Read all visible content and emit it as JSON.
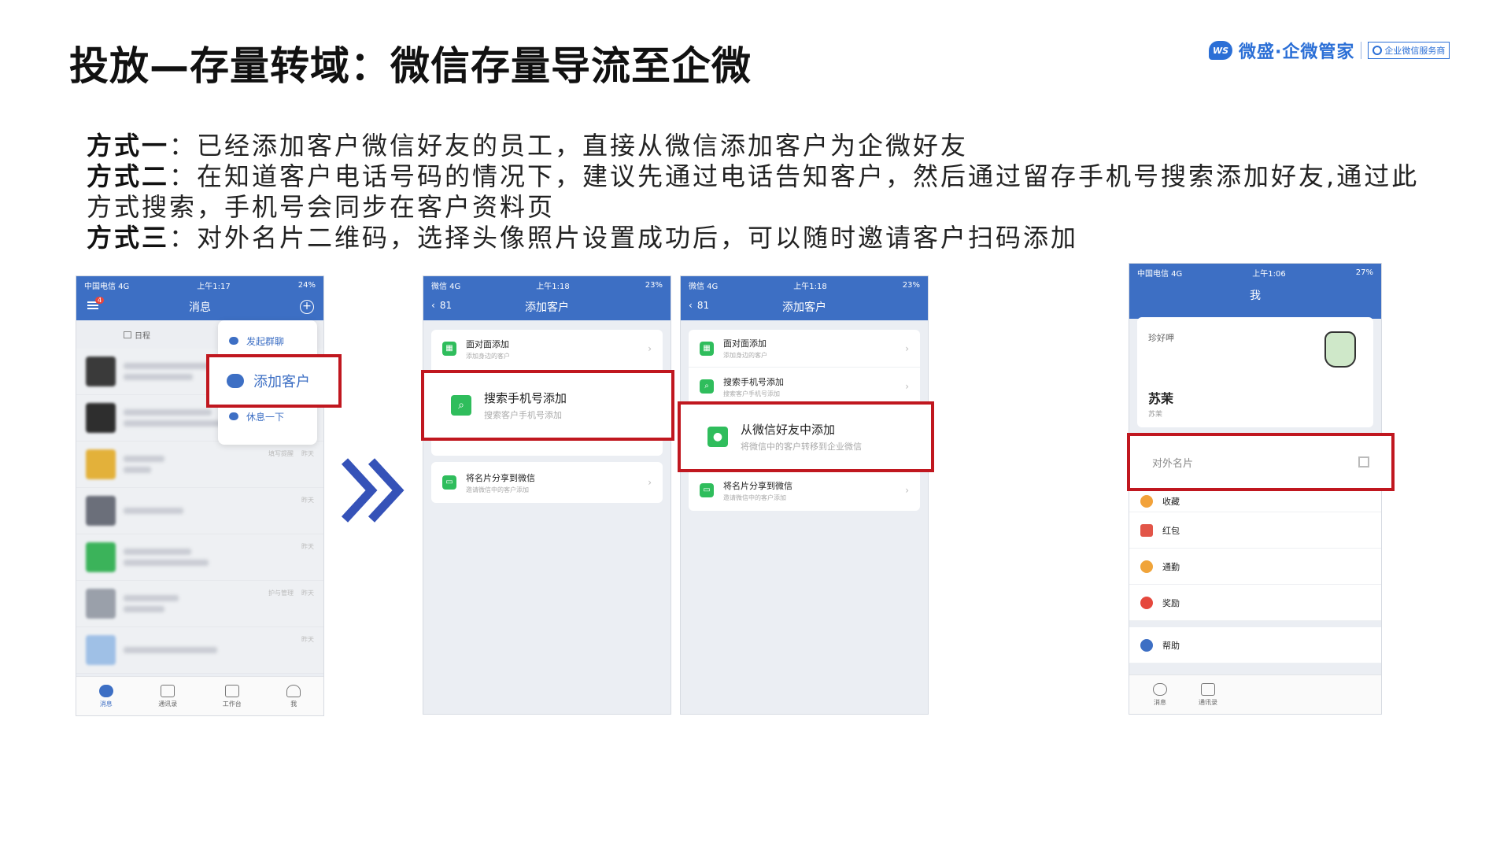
{
  "title": "投放—存量转域：微信存量导流至企微",
  "logo": {
    "badge": "WS",
    "brand": "微盛·企微管家",
    "tag": "企业微信服务商",
    "brand_color": "#2b6fd6"
  },
  "methods": [
    {
      "label": "方式一",
      "text": "：已经添加客户微信好友的员工，直接从微信添加客户为企微好友"
    },
    {
      "label": "方式二",
      "text": "：在知道客户电话号码的情况下，建议先通过电话告知客户，然后通过留存手机号搜索添加好友,通过此方式搜索，手机号会同步在客户资料页"
    },
    {
      "label": "方式三",
      "text": "：对外名片二维码，选择头像照片设置成功后，可以随时邀请客户扫码添加"
    }
  ],
  "colors": {
    "accent": "#3d6fc4",
    "highlight": "#c0171f",
    "wechat_green": "#2fbd5c"
  },
  "phone1": {
    "status_left": "中国电信 4G",
    "status_time": "上午1:17",
    "status_right": "24%",
    "badge": "4",
    "nav_title": "消息",
    "schedule": "日程",
    "popup_items": [
      "发起群聊",
      "添加客户",
      "休息一下"
    ],
    "row_texts": [
      "管",
      "手",
      "填写提醒",
      "",
      "",
      "护与管理",
      ""
    ],
    "row_times": [
      "",
      "",
      "昨天",
      "昨天",
      "昨天",
      "昨天",
      "昨天"
    ],
    "tabs": [
      "消息",
      "通讯录",
      "工作台",
      "我"
    ]
  },
  "phone2": {
    "status_left": "微信 4G",
    "status_time": "上午1:18",
    "status_right": "23%",
    "back_count": "81",
    "nav_title": "添加客户",
    "options": [
      {
        "main": "面对面添加",
        "sub": "添加身边的客户"
      },
      {
        "main": "搜索手机号添加",
        "sub": "搜索客户手机号添加"
      },
      {
        "main": "将名片分享到微信",
        "sub": "邀请微信中的客户添加"
      }
    ]
  },
  "phone3": {
    "status_left": "微信 4G",
    "status_time": "上午1:18",
    "status_right": "23%",
    "back_count": "81",
    "nav_title": "添加客户",
    "options": [
      {
        "main": "面对面添加",
        "sub": "添加身边的客户"
      },
      {
        "main": "搜索手机号添加",
        "sub": "搜索客户手机号添加"
      },
      {
        "main": "从微信好友中添加",
        "sub": "将微信中的客户转移到企业微信"
      },
      {
        "main": "将名片分享到微信",
        "sub": "邀请微信中的客户添加"
      }
    ]
  },
  "phone4": {
    "status_left": "中国电信 4G",
    "status_time": "上午1:06",
    "status_right": "27%",
    "nav_title": "我",
    "company": "珍好呷",
    "name": "苏茉",
    "name_sub": "苏茉",
    "card_label": "对外名片",
    "rows": [
      "收藏",
      "红包",
      "通勤",
      "奖励",
      "帮助"
    ],
    "tabs": [
      "消息",
      "通讯录"
    ]
  }
}
